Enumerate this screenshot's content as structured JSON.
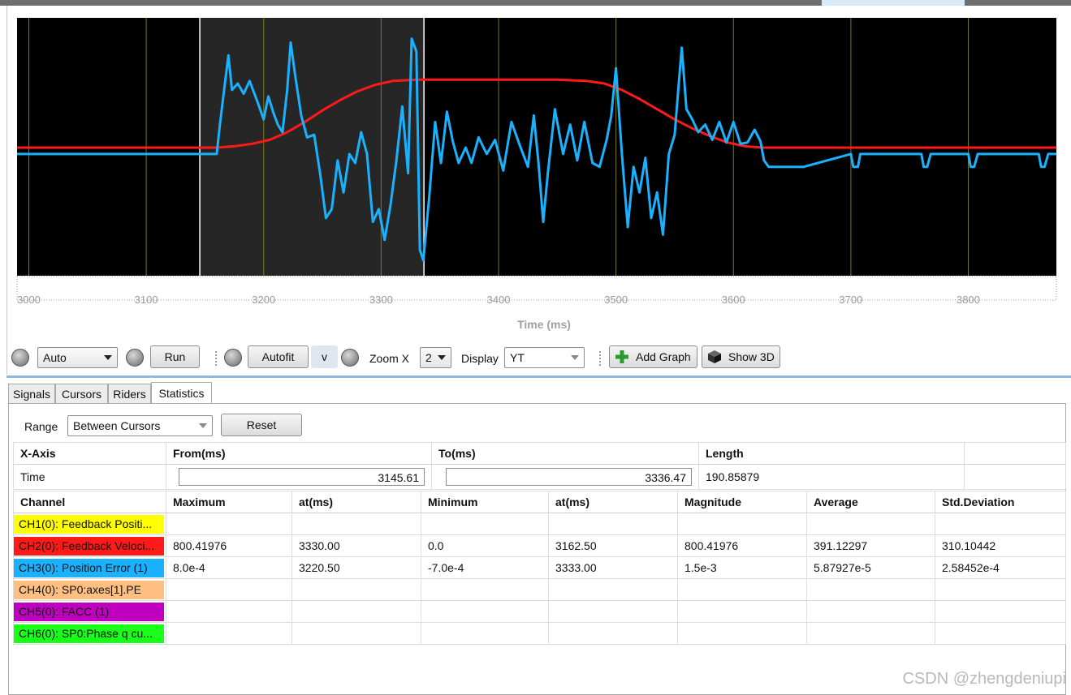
{
  "chart": {
    "xlabel": "Time (ms)",
    "x_ticks": [
      "3000",
      "3100",
      "3200",
      "3300",
      "3400",
      "3500",
      "3600",
      "3700",
      "3800"
    ],
    "background": "#000000",
    "cursor_band_color": "#262626",
    "gridline_color": "#7a7a1a"
  },
  "chart_data": {
    "type": "line",
    "xlabel": "Time (ms)",
    "ylabel": "",
    "xlim": [
      2990,
      3875
    ],
    "ylim": [
      -1,
      1
    ],
    "grid": true,
    "cursors": [
      3145.61,
      3336.47
    ],
    "series": [
      {
        "name": "CH2(0): Feedback Velocity",
        "color": "#ff1a1a",
        "x": [
          2990,
          3160,
          3175,
          3190,
          3205,
          3220,
          3235,
          3250,
          3265,
          3280,
          3295,
          3310,
          3330,
          3350,
          3400,
          3450,
          3475,
          3490,
          3505,
          3520,
          3535,
          3550,
          3565,
          3580,
          3595,
          3610,
          3625,
          3875
        ],
        "y": [
          0.0,
          0.0,
          0.01,
          0.03,
          0.06,
          0.12,
          0.2,
          0.29,
          0.37,
          0.44,
          0.49,
          0.52,
          0.53,
          0.53,
          0.53,
          0.53,
          0.52,
          0.5,
          0.45,
          0.38,
          0.3,
          0.22,
          0.15,
          0.09,
          0.04,
          0.01,
          0.0,
          0.0
        ]
      },
      {
        "name": "CH3(0): Position Error (1)",
        "color": "#1ab2ff",
        "x": [
          2990,
          3160,
          3163,
          3167,
          3170,
          3173,
          3178,
          3183,
          3188,
          3195,
          3200,
          3204,
          3208,
          3212,
          3216,
          3220,
          3223,
          3227,
          3232,
          3237,
          3243,
          3248,
          3253,
          3258,
          3263,
          3268,
          3273,
          3278,
          3283,
          3288,
          3293,
          3298,
          3303,
          3308,
          3313,
          3318,
          3323,
          3326,
          3330,
          3333,
          3336,
          3341,
          3346,
          3351,
          3356,
          3361,
          3366,
          3372,
          3377,
          3383,
          3390,
          3397,
          3404,
          3411,
          3418,
          3425,
          3430,
          3434,
          3438,
          3442,
          3448,
          3455,
          3461,
          3467,
          3473,
          3480,
          3486,
          3492,
          3496,
          3500,
          3505,
          3510,
          3515,
          3520,
          3525,
          3530,
          3535,
          3540,
          3545,
          3550,
          3553,
          3556,
          3560,
          3565,
          3570,
          3576,
          3582,
          3588,
          3594,
          3600,
          3606,
          3612,
          3618,
          3623,
          3626,
          3630,
          3660,
          3700,
          3702,
          3704,
          3706,
          3708,
          3760,
          3762,
          3765,
          3768,
          3800,
          3802,
          3805,
          3808,
          3860,
          3862,
          3865,
          3868,
          3875
        ],
        "y": [
          -0.05,
          -0.05,
          0.2,
          0.5,
          0.72,
          0.45,
          0.5,
          0.42,
          0.52,
          0.35,
          0.22,
          0.4,
          0.28,
          0.18,
          0.12,
          0.45,
          0.82,
          0.55,
          0.25,
          0.08,
          0.1,
          -0.2,
          -0.55,
          -0.48,
          -0.1,
          -0.35,
          -0.05,
          -0.12,
          0.12,
          -0.05,
          -0.58,
          -0.48,
          -0.72,
          -0.45,
          -0.1,
          0.32,
          -0.2,
          0.85,
          0.75,
          -0.8,
          -0.88,
          -0.38,
          0.2,
          -0.12,
          0.28,
          0.05,
          -0.12,
          0.0,
          -0.12,
          0.08,
          -0.05,
          0.06,
          -0.18,
          0.2,
          0.02,
          -0.15,
          0.25,
          -0.12,
          -0.58,
          -0.2,
          0.3,
          -0.05,
          0.18,
          -0.1,
          0.2,
          -0.12,
          -0.15,
          0.06,
          0.25,
          0.62,
          -0.05,
          -0.62,
          -0.15,
          -0.35,
          -0.08,
          -0.55,
          -0.35,
          -0.68,
          -0.05,
          0.1,
          0.45,
          0.78,
          0.3,
          0.22,
          0.12,
          0.18,
          0.06,
          0.2,
          0.04,
          0.2,
          0.03,
          0.04,
          0.14,
          0.05,
          -0.1,
          -0.15,
          -0.15,
          -0.05,
          -0.15,
          -0.15,
          -0.15,
          -0.05,
          -0.05,
          -0.15,
          -0.15,
          -0.05,
          -0.05,
          -0.15,
          -0.15,
          -0.05,
          -0.05,
          -0.15,
          -0.15,
          -0.05,
          -0.05
        ]
      }
    ]
  },
  "toolbar": {
    "mode_select": "Auto",
    "run_label": "Run",
    "autofit_label": "Autofit",
    "v_label": "v",
    "zoom_label": "Zoom X",
    "zoom_value": "2",
    "display_label": "Display",
    "display_value": "YT",
    "add_graph_label": "Add Graph",
    "show3d_label": "Show 3D"
  },
  "tabs": [
    "Signals",
    "Cursors",
    "Riders",
    "Statistics"
  ],
  "stats": {
    "range_label": "Range",
    "range_value": "Between Cursors",
    "reset_label": "Reset",
    "axis_headers": [
      "X-Axis",
      "From(ms)",
      "To(ms)",
      "Length"
    ],
    "axis_row": {
      "name": "Time",
      "from": "3145.61",
      "to": "3336.47",
      "length": "190.85879"
    },
    "channel_headers": [
      "Channel",
      "Maximum",
      "at(ms)",
      "Minimum",
      "at(ms)",
      "Magnitude",
      "Average",
      "Std.Deviation"
    ],
    "channels": [
      {
        "name": "CH1(0): Feedback Positi...",
        "color": "#ffff00",
        "maximum": "",
        "max_at": "",
        "minimum": "",
        "min_at": "",
        "magnitude": "",
        "average": "",
        "std": ""
      },
      {
        "name": "CH2(0): Feedback Veloci...",
        "color": "#ff1a1a",
        "maximum": "800.41976",
        "max_at": "3330.00",
        "minimum": "0.0",
        "min_at": "3162.50",
        "magnitude": "800.41976",
        "average": "391.12297",
        "std": "310.10442"
      },
      {
        "name": "CH3(0): Position Error (1)",
        "color": "#1ab2ff",
        "maximum": "8.0e-4",
        "max_at": "3220.50",
        "minimum": "-7.0e-4",
        "min_at": "3333.00",
        "magnitude": "1.5e-3",
        "average": "5.87927e-5",
        "std": "2.58452e-4"
      },
      {
        "name": "CH4(0): SP0:axes[1].PE",
        "color": "#ffbf80",
        "maximum": "",
        "max_at": "",
        "minimum": "",
        "min_at": "",
        "magnitude": "",
        "average": "",
        "std": ""
      },
      {
        "name": "CH5(0): FACC (1)",
        "color": "#bf00bf",
        "maximum": "",
        "max_at": "",
        "minimum": "",
        "min_at": "",
        "magnitude": "",
        "average": "",
        "std": ""
      },
      {
        "name": "CH6(0): SP0:Phase q cu...",
        "color": "#1aff1a",
        "maximum": "",
        "max_at": "",
        "minimum": "",
        "min_at": "",
        "magnitude": "",
        "average": "",
        "std": ""
      }
    ]
  },
  "watermark": "CSDN @zhengdeniupi"
}
